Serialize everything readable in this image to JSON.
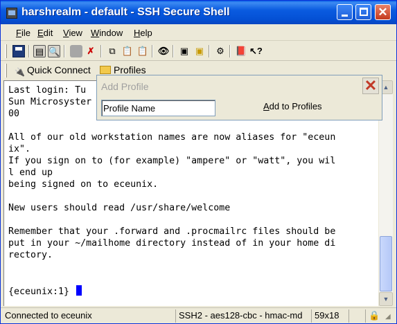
{
  "window": {
    "title": "harshrealm - default - SSH Secure Shell"
  },
  "menu": {
    "items": [
      "File",
      "Edit",
      "View",
      "Window",
      "Help"
    ]
  },
  "quickbar": {
    "quick_connect": "Quick Connect",
    "profiles": "Profiles"
  },
  "popup": {
    "title": "Add Profile",
    "input_value": "Profile Name",
    "add_button": "Add to Profiles"
  },
  "terminal": {
    "lines": [
      "Last login: Tu",
      "Sun Microsyster",
      "00",
      "",
      "All of our old workstation names are now aliases for \"eceun",
      "ix\".",
      "If you sign on to (for example) \"ampere\" or \"watt\", you wil",
      "l end up",
      "being signed on to eceunix.",
      "",
      "New users should read /usr/share/welcome",
      "",
      "Remember that your .forward and .procmailrc files should be",
      "put in your ~/mailhome directory instead of in your home di",
      "rectory.",
      "",
      "",
      "{eceunix:1} "
    ]
  },
  "status": {
    "connection": "Connected to eceunix",
    "protocol": "SSH2 - aes128-cbc - hmac-md",
    "size": "59x18"
  },
  "colors": {
    "titlebar": "#0a5be0",
    "cursor": "#0000ff",
    "close": "#c4391d"
  }
}
